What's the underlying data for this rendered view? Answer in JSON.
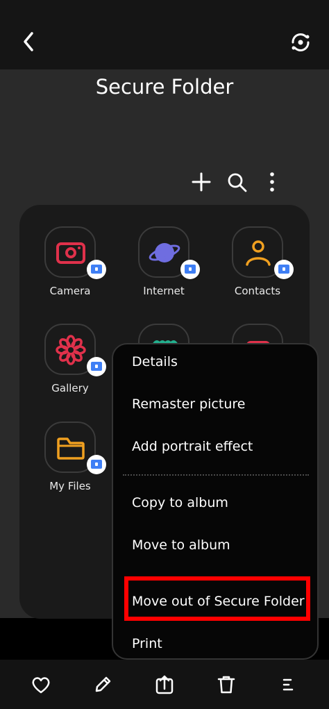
{
  "header": {
    "title": "Secure Folder"
  },
  "apps": [
    {
      "label": "Camera"
    },
    {
      "label": "Internet"
    },
    {
      "label": "Contacts"
    },
    {
      "label": "Gallery"
    },
    {
      "label": "My Files"
    }
  ],
  "context_menu": {
    "items": [
      "Details",
      "Remaster picture",
      "Add portrait effect",
      "Copy to album",
      "Move to album",
      "Move out of Secure Folder",
      "Print"
    ]
  },
  "colors": {
    "highlight": "#ff0000",
    "badge": "#3f7ff5",
    "camera": "#e0314b",
    "internet": "#6f6de0",
    "contacts": "#f0a020",
    "gallery": "#e0314b",
    "myfiles": "#f0a020"
  },
  "icons": [
    "back-icon",
    "settings-icon",
    "add-icon",
    "search-icon",
    "more-options-icon",
    "favorite-icon",
    "edit-icon",
    "share-icon",
    "delete-icon",
    "menu-icon"
  ]
}
